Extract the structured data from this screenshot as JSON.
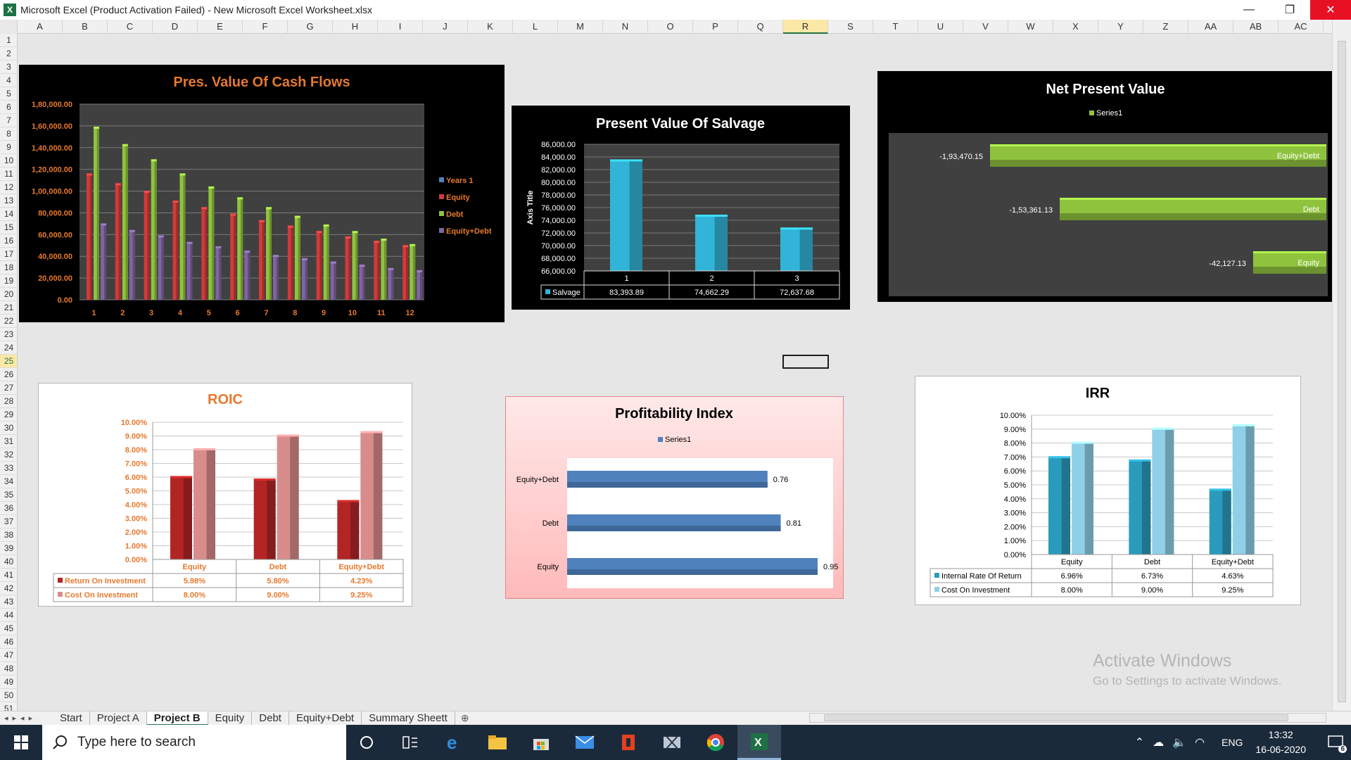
{
  "window": {
    "title": "Microsoft Excel (Product Activation Failed) - New Microsoft Excel Worksheet.xlsx",
    "app_icon": "X",
    "minimize": "—",
    "maximize": "❐",
    "close": "✕"
  },
  "grid": {
    "columns": [
      "A",
      "B",
      "C",
      "D",
      "E",
      "F",
      "G",
      "H",
      "I",
      "J",
      "K",
      "L",
      "M",
      "N",
      "O",
      "P",
      "Q",
      "R",
      "S",
      "T",
      "U",
      "V",
      "W",
      "X",
      "Y",
      "Z",
      "AA",
      "AB",
      "AC"
    ],
    "selected_column": "R",
    "rows": [
      "1",
      "2",
      "3",
      "4",
      "5",
      "6",
      "7",
      "8",
      "9",
      "10",
      "11",
      "12",
      "13",
      "14",
      "15",
      "16",
      "17",
      "18",
      "19",
      "20",
      "21",
      "22",
      "23",
      "24",
      "25",
      "26",
      "27",
      "28",
      "29",
      "30",
      "31",
      "32",
      "33",
      "34",
      "35",
      "36",
      "37",
      "38",
      "39",
      "40",
      "41",
      "42",
      "43",
      "44",
      "45",
      "46",
      "47",
      "48",
      "49",
      "50",
      "51"
    ],
    "selected_row": "25"
  },
  "charts": {
    "pv_cash_flows": {
      "title": "Pres. Value Of Cash Flows",
      "yticks": [
        "1,80,000.00",
        "1,60,000.00",
        "1,40,000.00",
        "1,20,000.00",
        "1,00,000.00",
        "80,000.00",
        "60,000.00",
        "40,000.00",
        "20,000.00",
        "0.00"
      ],
      "legend": [
        "Years 1",
        "Equity",
        "Debt",
        "Equity+Debt"
      ]
    },
    "pv_salvage": {
      "title": "Present Value Of Salvage",
      "axis_title": "Axis Title",
      "yticks": [
        "86,000.00",
        "84,000.00",
        "82,000.00",
        "80,000.00",
        "78,000.00",
        "76,000.00",
        "74,000.00",
        "72,000.00",
        "70,000.00",
        "68,000.00",
        "66,000.00"
      ],
      "series_label": "Salvage",
      "table_values": [
        "83,393.89",
        "74,662.29",
        "72,637.68"
      ]
    },
    "npv": {
      "title": "Net Present Value",
      "legend": "Series1",
      "value_labels": [
        "-1,93,470.15",
        "-1,53,361.13",
        "-42,127.13"
      ]
    },
    "roic": {
      "title": "ROIC",
      "yticks": [
        "10.00%",
        "9.00%",
        "8.00%",
        "7.00%",
        "6.00%",
        "5.00%",
        "4.00%",
        "3.00%",
        "2.00%",
        "1.00%",
        "0.00%"
      ],
      "row1_label": "Return On Investment",
      "row2_label": "Cost On Investment",
      "row1_values": [
        "5.98%",
        "5.80%",
        "4.23%"
      ],
      "row2_values": [
        "8.00%",
        "9.00%",
        "9.25%"
      ]
    },
    "pi": {
      "title": "Profitability Index",
      "legend": "Series1",
      "value_labels": [
        "0.76",
        "0.81",
        "0.95"
      ]
    },
    "irr": {
      "title": "IRR",
      "yticks": [
        "10.00%",
        "9.00%",
        "8.00%",
        "7.00%",
        "6.00%",
        "5.00%",
        "4.00%",
        "3.00%",
        "2.00%",
        "1.00%",
        "0.00%"
      ],
      "row1_label": "Internal Rate Of Return",
      "row2_label": "Cost On Investment",
      "row1_values": [
        "6.96%",
        "6.73%",
        "4.63%"
      ],
      "row2_values": [
        "8.00%",
        "9.00%",
        "9.25%"
      ]
    }
  },
  "chart_data": [
    {
      "type": "bar",
      "title": "Pres. Value Of Cash Flows",
      "categories": [
        "1",
        "2",
        "3",
        "4",
        "5",
        "6",
        "7",
        "8",
        "9",
        "10",
        "11",
        "12"
      ],
      "ylim": [
        0,
        180000
      ],
      "legend_position": "right",
      "series": [
        {
          "name": "Years 1",
          "color": "#4f81bd",
          "values": [
            0,
            0,
            0,
            0,
            0,
            0,
            0,
            0,
            0,
            0,
            0,
            0
          ]
        },
        {
          "name": "Equity",
          "color": "#d23a3a",
          "values": [
            115000,
            106000,
            99000,
            90000,
            84000,
            78000,
            72000,
            67000,
            62000,
            57000,
            53000,
            49000
          ]
        },
        {
          "name": "Debt",
          "color": "#8fc33e",
          "values": [
            158000,
            142000,
            128000,
            115000,
            103000,
            93000,
            84000,
            76000,
            68000,
            62000,
            55000,
            50000
          ]
        },
        {
          "name": "Equity+Debt",
          "color": "#8064a2",
          "values": [
            69000,
            63000,
            58000,
            52000,
            48000,
            44000,
            40000,
            37000,
            34000,
            31000,
            28000,
            26000
          ]
        }
      ]
    },
    {
      "type": "bar",
      "title": "Present Value Of Salvage",
      "ylabel": "Axis Title",
      "categories": [
        "1",
        "2",
        "3"
      ],
      "ylim": [
        66000,
        86000
      ],
      "series": [
        {
          "name": "Salvage",
          "color": "#31b4d8",
          "values": [
            83393.89,
            74662.29,
            72637.68
          ]
        }
      ]
    },
    {
      "type": "bar",
      "orientation": "horizontal",
      "title": "Net Present Value",
      "categories": [
        "Equity+Debt",
        "Debt",
        "Equity"
      ],
      "series": [
        {
          "name": "Series1",
          "color": "#8fc33e",
          "values": [
            -193470.15,
            -153361.13,
            -42127.13
          ]
        }
      ]
    },
    {
      "type": "bar",
      "title": "ROIC",
      "categories": [
        "Equity",
        "Debt",
        "Equity+Debt"
      ],
      "ylim": [
        0,
        10
      ],
      "series": [
        {
          "name": "Return On Investment",
          "color": "#b32525",
          "values": [
            5.98,
            5.8,
            4.23
          ]
        },
        {
          "name": "Cost On Investment",
          "color": "#d98c8c",
          "values": [
            8.0,
            9.0,
            9.25
          ]
        }
      ]
    },
    {
      "type": "bar",
      "orientation": "horizontal",
      "title": "Profitability Index",
      "categories": [
        "Equity+Debt",
        "Debt",
        "Equity"
      ],
      "xlim": [
        0,
        1
      ],
      "series": [
        {
          "name": "Series1",
          "color": "#4f81bd",
          "values": [
            0.76,
            0.81,
            0.95
          ]
        }
      ]
    },
    {
      "type": "bar",
      "title": "IRR",
      "categories": [
        "Equity",
        "Debt",
        "Equity+Debt"
      ],
      "ylim": [
        0,
        10
      ],
      "series": [
        {
          "name": "Internal Rate Of Return",
          "color": "#2a9bbc",
          "values": [
            6.96,
            6.73,
            4.63
          ]
        },
        {
          "name": "Cost On Investment",
          "color": "#8fd0e8",
          "values": [
            8.0,
            9.0,
            9.25
          ]
        }
      ]
    }
  ],
  "sheet_tabs": [
    "Start",
    "Project A",
    "Project B",
    "Equity",
    "Debt",
    "Equity+Debt",
    "Summary Sheett"
  ],
  "active_tab": "Project B",
  "watermark": {
    "line1": "Activate Windows",
    "line2": "Go to Settings to activate Windows."
  },
  "taskbar": {
    "search_placeholder": "Type here to search",
    "language": "ENG",
    "time": "13:32",
    "date": "16-06-2020",
    "notification_count": "6"
  },
  "colors": {
    "excel_green": "#217346",
    "taskbar_bg": "#1b2a3b",
    "close_red": "#e81123",
    "orange_text": "#e6792e"
  }
}
